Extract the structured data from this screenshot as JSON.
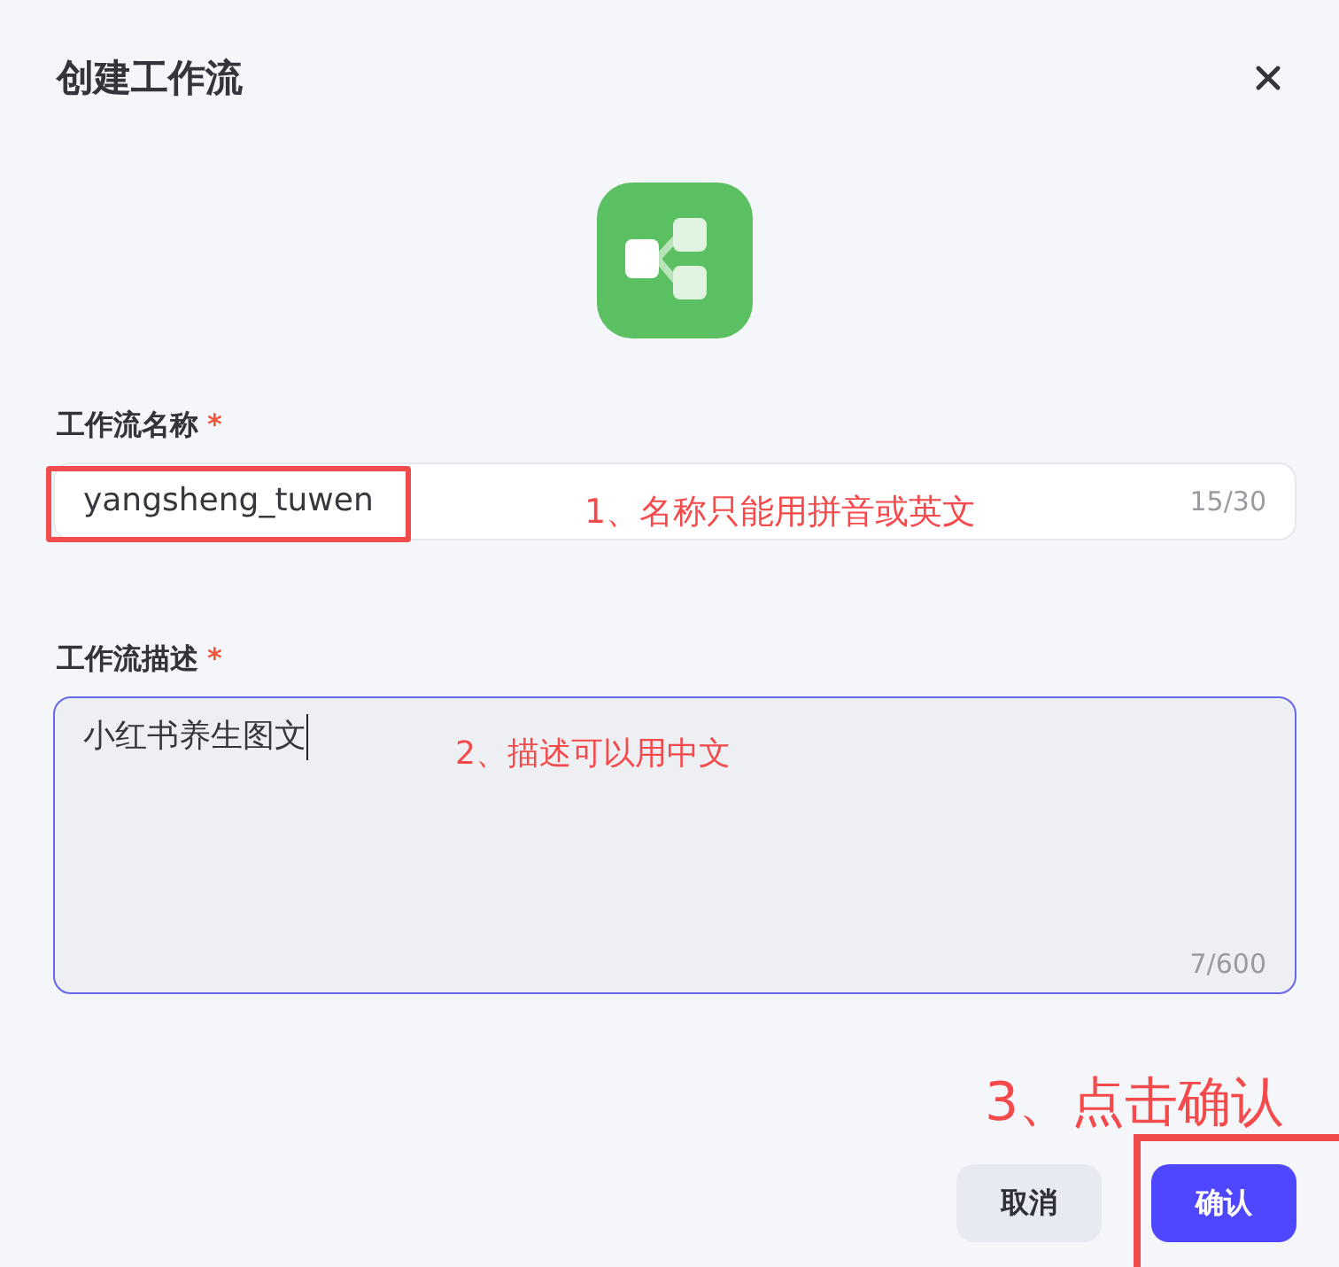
{
  "dialog": {
    "title": "创建工作流"
  },
  "fields": [
    {
      "kind": "input",
      "label": "工作流名称",
      "required_mark": "*",
      "value": "yangsheng_tuwen",
      "counter": "15/30",
      "focused": false,
      "annotation": "1、名称只能用拼音或英文",
      "value_framed": true
    },
    {
      "kind": "textarea",
      "label": "工作流描述",
      "required_mark": "*",
      "value": "小红书养生图文",
      "counter": "7/600",
      "focused": true,
      "annotation": "2、描述可以用中文",
      "value_framed": false
    }
  ],
  "buttons": [
    {
      "kind": "secondary",
      "label": "取消",
      "framed": false
    },
    {
      "kind": "primary",
      "label": "确认",
      "framed": true,
      "annotation": "3、点击确认"
    }
  ]
}
